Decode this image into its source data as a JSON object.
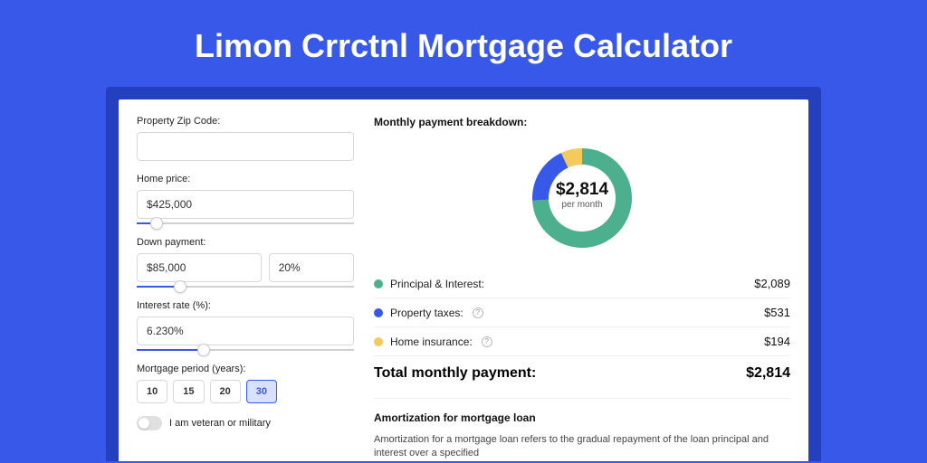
{
  "title": "Limon Crrctnl Mortgage Calculator",
  "form": {
    "zip_label": "Property Zip Code:",
    "zip_value": "",
    "home_price_label": "Home price:",
    "home_price_value": "$425,000",
    "home_price_slider_pct": 9,
    "down_label": "Down payment:",
    "down_value": "$85,000",
    "down_pct": "20%",
    "down_slider_pct": 20,
    "rate_label": "Interest rate (%):",
    "rate_value": "6.230%",
    "rate_slider_pct": 31,
    "period_label": "Mortgage period (years):",
    "periods": [
      "10",
      "15",
      "20",
      "30"
    ],
    "period_active_index": 3,
    "veteran_label": "I am veteran or military"
  },
  "breakdown": {
    "title": "Monthly payment breakdown:",
    "center_amount": "$2,814",
    "center_sub": "per month",
    "items": [
      {
        "label": "Principal & Interest:",
        "value": "$2,089",
        "color": "#4caf8e",
        "info": false
      },
      {
        "label": "Property taxes:",
        "value": "$531",
        "color": "#3858e9",
        "info": true
      },
      {
        "label": "Home insurance:",
        "value": "$194",
        "color": "#f4c95d",
        "info": true
      }
    ],
    "total_label": "Total monthly payment:",
    "total_value": "$2,814"
  },
  "chart_data": {
    "type": "pie",
    "title": "Monthly payment breakdown",
    "series": [
      {
        "name": "Principal & Interest",
        "value": 2089,
        "color": "#4caf8e"
      },
      {
        "name": "Property taxes",
        "value": 531,
        "color": "#3858e9"
      },
      {
        "name": "Home insurance",
        "value": 194,
        "color": "#f4c95d"
      }
    ],
    "total": 2814
  },
  "amortization": {
    "title": "Amortization for mortgage loan",
    "text": "Amortization for a mortgage loan refers to the gradual repayment of the loan principal and interest over a specified"
  }
}
